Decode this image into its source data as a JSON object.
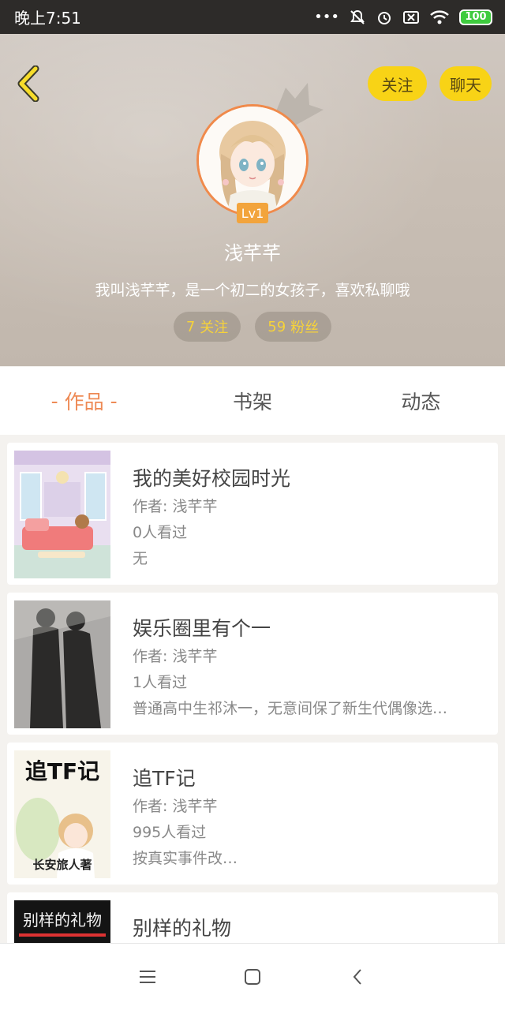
{
  "status_bar": {
    "time": "晚上7:51",
    "battery": "100"
  },
  "header": {
    "follow_label": "关注",
    "chat_label": "聊天",
    "level": "Lv1",
    "username": "浅芊芊",
    "bio": "我叫浅芊芊，是一个初二的女孩子，喜欢私聊哦",
    "stats": [
      {
        "count": "7",
        "label": "关注"
      },
      {
        "count": "59",
        "label": "粉丝"
      }
    ]
  },
  "tabs": [
    {
      "label": "作品",
      "active": true
    },
    {
      "label": "书架",
      "active": false
    },
    {
      "label": "动态",
      "active": false
    }
  ],
  "works": [
    {
      "title": "我的美好校园时光",
      "author": "作者: 浅芊芊",
      "views": "0人看过",
      "desc": "无"
    },
    {
      "title": "娱乐圈里有个一",
      "author": "作者: 浅芊芊",
      "views": "1人看过",
      "desc": "普通高中生祁沐一，无意间保了新生代偶像选…"
    },
    {
      "title": "追TF记",
      "author": "作者: 浅芊芊",
      "views": "995人看过",
      "desc": "按真实事件改…"
    },
    {
      "title": "别样的礼物",
      "author": "",
      "views": "",
      "desc": ""
    }
  ],
  "covers": {
    "cover3_title": "追TF记",
    "cover3_author": "长安旅人著",
    "cover4_title": "别样的礼物"
  },
  "colors": {
    "accent": "#ee8a55",
    "button_yellow": "#f8d316",
    "stat_text": "#f6d23a"
  }
}
